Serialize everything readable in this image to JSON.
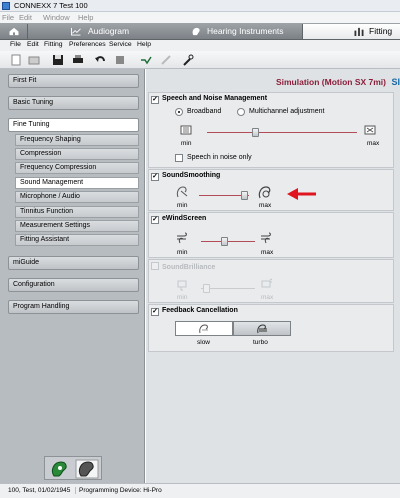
{
  "window": {
    "title": "CONNEXX 7 Test 100"
  },
  "os_menu": [
    "File",
    "Edit",
    "Window",
    "Help"
  ],
  "tabs": [
    {
      "label": "Audiogram"
    },
    {
      "label": "Hearing Instruments"
    },
    {
      "label": "Fitting"
    }
  ],
  "app_menu": [
    "File",
    "Edit",
    "Fitting",
    "Preferences",
    "Service",
    "Help"
  ],
  "sidebar": {
    "first_fit": "First Fit",
    "basic_tuning": "Basic Tuning",
    "fine_tuning": "Fine Tuning",
    "sub_items": [
      "Frequency Shaping",
      "Compression",
      "Frequency Compression",
      "Sound Management",
      "Microphone / Audio",
      "Tinnitus Function",
      "Measurement Settings",
      "Fitting Assistant"
    ],
    "miguide": "miGuide",
    "configuration": "Configuration",
    "program_handling": "Program Handling"
  },
  "main": {
    "simulation_title": "Simulation (Motion SX 7mi)",
    "brand_fragment": "SI",
    "speech_noise": {
      "title": "Speech and Noise Management",
      "option_broadband": "Broadband",
      "option_multichannel": "Multichannel adjustment",
      "min": "min",
      "max": "max",
      "speech_in_noise": "Speech in noise only"
    },
    "sound_smoothing": {
      "title": "SoundSmoothing",
      "min": "min",
      "max": "max"
    },
    "ewindscreen": {
      "title": "eWindScreen",
      "min": "min",
      "max": "max"
    },
    "soundbrilliance": {
      "title": "SoundBrilliance",
      "min": "min",
      "max": "max"
    },
    "feedback": {
      "title": "Feedback Cancellation",
      "slow": "slow",
      "turbo": "turbo"
    }
  },
  "statusbar": {
    "patient": "100, Test, 01/02/1945",
    "device": "Programming Device: Hi-Pro"
  },
  "colors": {
    "accent": "#8a1f3a",
    "brand": "#1a6aa6",
    "arrow": "#e0141e",
    "slider": "#b24c56"
  }
}
